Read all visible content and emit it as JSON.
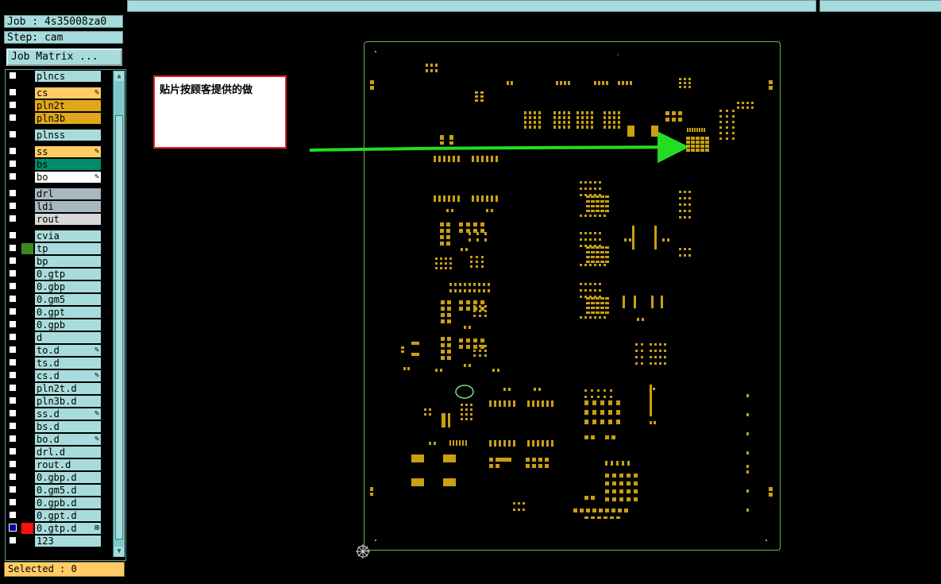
{
  "job": {
    "label": "Job : 4s35008za0"
  },
  "step": {
    "label": "Step: cam"
  },
  "job_matrix_button": "Job Matrix ...",
  "layers": [
    {
      "name": "plncs",
      "bg": "#a8dcdc",
      "swatch": "#000000",
      "pen": false
    },
    {
      "name": "cs",
      "bg": "#ffcc66",
      "swatch": "#000000",
      "pen": true
    },
    {
      "name": "pln2t",
      "bg": "#e0a818",
      "swatch": "#000000",
      "pen": false
    },
    {
      "name": "pln3b",
      "bg": "#e0a818",
      "swatch": "#000000",
      "pen": false
    },
    {
      "name": "plnss",
      "bg": "#a8dcdc",
      "swatch": "#000000",
      "pen": false
    },
    {
      "name": "ss",
      "bg": "#ffcc66",
      "swatch": "#000000",
      "pen": true
    },
    {
      "name": "bs",
      "bg": "#008c6a",
      "swatch": "#000000",
      "pen": false
    },
    {
      "name": "bo",
      "bg": "#ffffff",
      "swatch": "#000000",
      "pen": true
    },
    {
      "name": "drl",
      "bg": "#a9b8c0",
      "swatch": "#000000",
      "pen": false
    },
    {
      "name": "ldi",
      "bg": "#a9b8c0",
      "swatch": "#000000",
      "pen": false
    },
    {
      "name": "rout",
      "bg": "#d8d8d8",
      "swatch": "#000000",
      "pen": false
    },
    {
      "name": "cvia",
      "bg": "#a8dcdc",
      "swatch": "#000000",
      "pen": false
    },
    {
      "name": "tp",
      "bg": "#a8dcdc",
      "swatch": "#3a8a20",
      "pen": false
    },
    {
      "name": "bp",
      "bg": "#a8dcdc",
      "swatch": "#000000",
      "pen": false
    },
    {
      "name": "0.gtp",
      "bg": "#a8dcdc",
      "swatch": "#000000",
      "pen": false
    },
    {
      "name": "0.gbp",
      "bg": "#a8dcdc",
      "swatch": "#000000",
      "pen": false
    },
    {
      "name": "0.gm5",
      "bg": "#a8dcdc",
      "swatch": "#000000",
      "pen": false
    },
    {
      "name": "0.gpt",
      "bg": "#a8dcdc",
      "swatch": "#000000",
      "pen": false
    },
    {
      "name": "0.gpb",
      "bg": "#a8dcdc",
      "swatch": "#000000",
      "pen": false
    },
    {
      "name": "d",
      "bg": "#a8dcdc",
      "swatch": "#000000",
      "pen": false
    },
    {
      "name": "to.d",
      "bg": "#a8dcdc",
      "swatch": "#000000",
      "pen": true
    },
    {
      "name": "ts.d",
      "bg": "#a8dcdc",
      "swatch": "#000000",
      "pen": false
    },
    {
      "name": "cs.d",
      "bg": "#a8dcdc",
      "swatch": "#000000",
      "pen": true
    },
    {
      "name": "pln2t.d",
      "bg": "#a8dcdc",
      "swatch": "#000000",
      "pen": false
    },
    {
      "name": "pln3b.d",
      "bg": "#a8dcdc",
      "swatch": "#000000",
      "pen": false
    },
    {
      "name": "ss.d",
      "bg": "#a8dcdc",
      "swatch": "#000000",
      "pen": true
    },
    {
      "name": "bs.d",
      "bg": "#a8dcdc",
      "swatch": "#000000",
      "pen": false
    },
    {
      "name": "bo.d",
      "bg": "#a8dcdc",
      "swatch": "#000000",
      "pen": true
    },
    {
      "name": "drl.d",
      "bg": "#a8dcdc",
      "swatch": "#000000",
      "pen": false
    },
    {
      "name": "rout.d",
      "bg": "#a8dcdc",
      "swatch": "#000000",
      "pen": false
    },
    {
      "name": "0.gbp.d",
      "bg": "#a8dcdc",
      "swatch": "#000000",
      "pen": false
    },
    {
      "name": "0.gm5.d",
      "bg": "#a8dcdc",
      "swatch": "#000000",
      "pen": false
    },
    {
      "name": "0.gpb.d",
      "bg": "#a8dcdc",
      "swatch": "#000000",
      "pen": false
    },
    {
      "name": "0.gpt.d",
      "bg": "#a8dcdc",
      "swatch": "#000000",
      "pen": false
    },
    {
      "name": "0.gtp.d",
      "bg": "#a8dcdc",
      "swatch": "#ff1010",
      "pen": false,
      "checked": true
    },
    {
      "name": "123",
      "bg": "#a8dcdc",
      "swatch": "#000000",
      "pen": false
    }
  ],
  "selected_status": "Selected : 0",
  "annotation": {
    "text": "贴片按顾客提供的做"
  },
  "colors": {
    "pad": "#c8a012",
    "board_outline": "#6ab04a",
    "arrow": "#22dd22",
    "highlight": "#7ea020"
  }
}
